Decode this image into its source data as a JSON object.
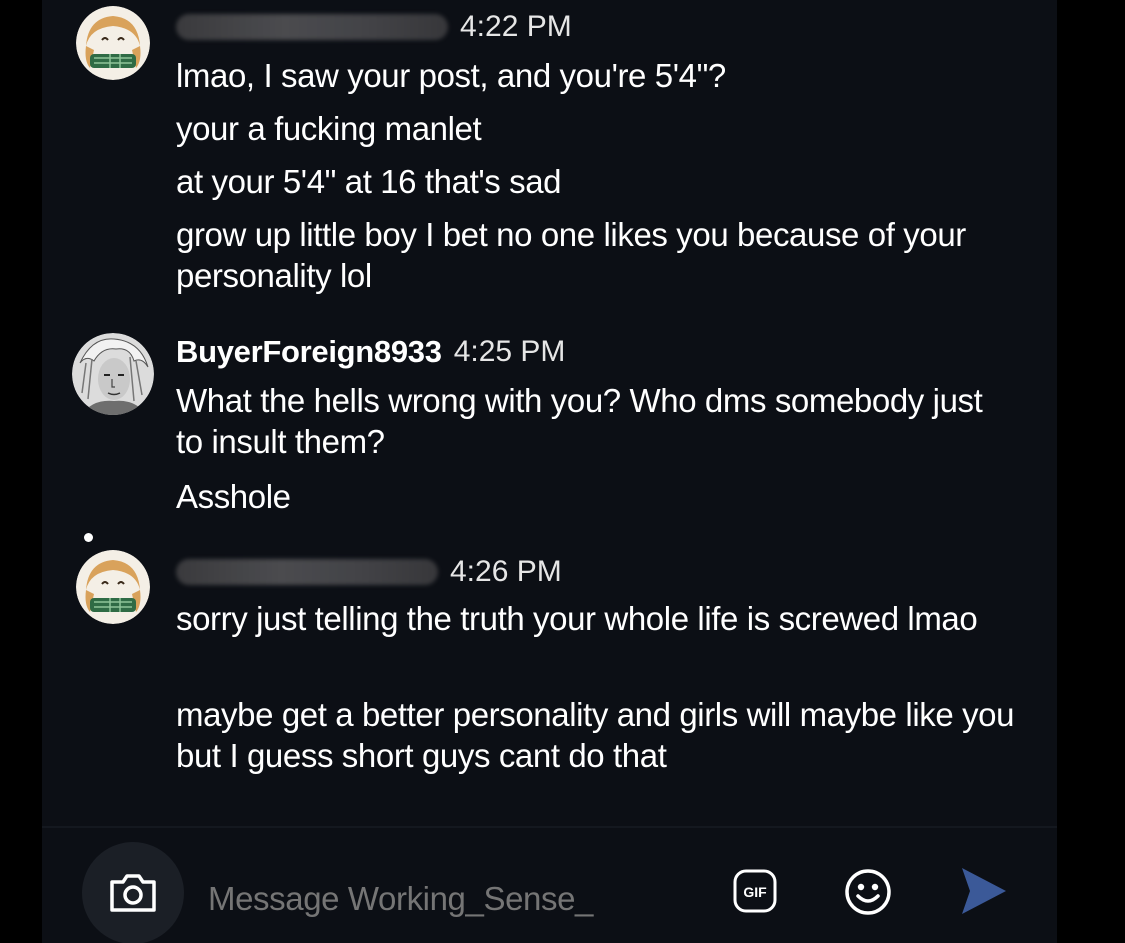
{
  "chat": {
    "groups": [
      {
        "sender": "",
        "sender_redacted": true,
        "time": "4:22 PM",
        "avatar": "anime-girl-scarf-avatar",
        "messages": [
          "lmao, I saw your post, and you're 5'4\"?",
          "your a fucking manlet",
          "at your 5'4\" at 16 that's sad",
          "grow up little boy I bet no one likes you because of your personality lol"
        ]
      },
      {
        "sender": "BuyerForeign8933",
        "sender_redacted": false,
        "time": "4:25 PM",
        "avatar": "manga-character-avatar",
        "messages": [
          "What the hells wrong with you? Who dms somebody just to insult them?",
          "Asshole"
        ]
      },
      {
        "sender": "",
        "sender_redacted": true,
        "time": "4:26 PM",
        "avatar": "anime-girl-scarf-avatar",
        "messages": [
          "sorry just telling the truth your whole life is screwed lmao",
          "maybe get a better personality and girls will maybe like you but I guess short guys cant do that"
        ]
      }
    ]
  },
  "composer": {
    "placeholder": "Message Working_Sense_",
    "camera_icon": "camera-icon",
    "gif_icon": "gif-icon",
    "gif_label": "GIF",
    "emoji_icon": "emoji-icon",
    "send_icon": "send-icon"
  },
  "colors": {
    "background": "#0c0f15",
    "text": "#ffffff",
    "placeholder": "#a8acb3",
    "send": "#3b5998"
  }
}
